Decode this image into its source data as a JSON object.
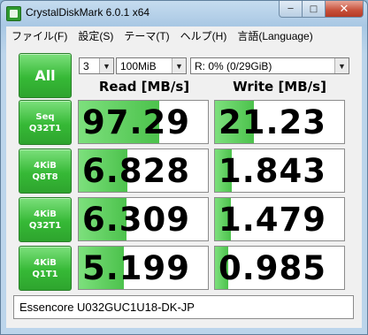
{
  "window": {
    "title": "CrystalDiskMark 6.0.1 x64",
    "controls": {
      "minimize": "─",
      "maximize": "□",
      "close": "✕"
    }
  },
  "menu": [
    "ファイル(F)",
    "設定(S)",
    "テーマ(T)",
    "ヘルプ(H)",
    "言語(Language)"
  ],
  "toolbar": {
    "all_label": "All",
    "count": "3",
    "size": "100MiB",
    "drive": "R: 0% (0/29GiB)",
    "dropdown_arrow": "▼"
  },
  "headers": {
    "read": "Read [MB/s]",
    "write": "Write [MB/s]"
  },
  "tests": [
    {
      "line1": "Seq",
      "line2": "Q32T1",
      "read": "97.29",
      "write": "21.23",
      "read_fill": 0.62,
      "write_fill": 0.3
    },
    {
      "line1": "4KiB",
      "line2": "Q8T8",
      "read": "6.828",
      "write": "1.843",
      "read_fill": 0.38,
      "write_fill": 0.13
    },
    {
      "line1": "4KiB",
      "line2": "Q32T1",
      "read": "6.309",
      "write": "1.479",
      "read_fill": 0.37,
      "write_fill": 0.12
    },
    {
      "line1": "4KiB",
      "line2": "Q1T1",
      "read": "5.199",
      "write": "0.985",
      "read_fill": 0.35,
      "write_fill": 0.1
    }
  ],
  "comment": "Essencore U032GUC1U18-DK-JP"
}
